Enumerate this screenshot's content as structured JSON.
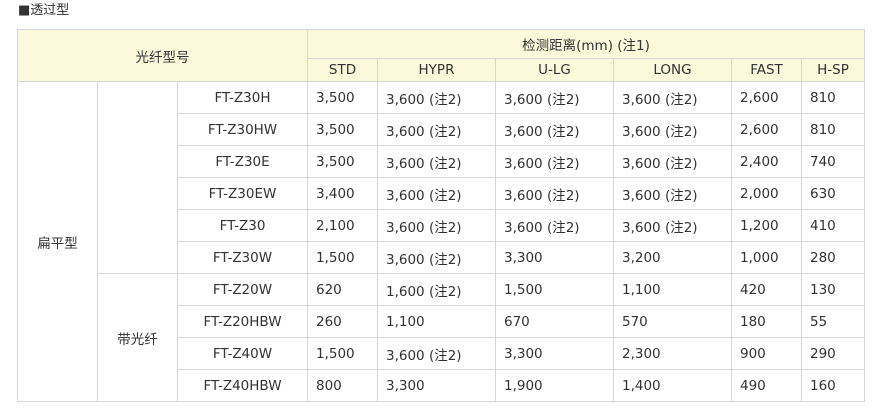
{
  "section_title": "■透过型",
  "header": {
    "model_label": "光纤型号",
    "distance_label": "检测距离(mm) (注1)",
    "columns": [
      "STD",
      "HYPR",
      "U-LG",
      "LONG",
      "FAST",
      "H-SP"
    ]
  },
  "category": "扁平型",
  "subgroups": [
    {
      "label": "",
      "rows": [
        {
          "model": "FT-Z30H",
          "values": [
            "3,500",
            "3,600 (注2)",
            "3,600 (注2)",
            "3,600 (注2)",
            "2,600",
            "810"
          ]
        },
        {
          "model": "FT-Z30HW",
          "values": [
            "3,500",
            "3,600 (注2)",
            "3,600 (注2)",
            "3,600 (注2)",
            "2,600",
            "810"
          ]
        },
        {
          "model": "FT-Z30E",
          "values": [
            "3,500",
            "3,600 (注2)",
            "3,600 (注2)",
            "3,600 (注2)",
            "2,400",
            "740"
          ]
        },
        {
          "model": "FT-Z30EW",
          "values": [
            "3,400",
            "3,600 (注2)",
            "3,600 (注2)",
            "3,600 (注2)",
            "2,000",
            "630"
          ]
        },
        {
          "model": "FT-Z30",
          "values": [
            "2,100",
            "3,600 (注2)",
            "3,600 (注2)",
            "3,600 (注2)",
            "1,200",
            "410"
          ]
        },
        {
          "model": "FT-Z30W",
          "values": [
            "1,500",
            "3,600 (注2)",
            "3,300",
            "3,200",
            "1,000",
            "280"
          ]
        }
      ]
    },
    {
      "label": "带光纤",
      "rows": [
        {
          "model": "FT-Z20W",
          "values": [
            "620",
            "1,600 (注2)",
            "1,500",
            "1,100",
            "420",
            "130"
          ]
        },
        {
          "model": "FT-Z20HBW",
          "values": [
            "260",
            "1,100",
            "670",
            "570",
            "180",
            "55"
          ]
        },
        {
          "model": "FT-Z40W",
          "values": [
            "1,500",
            "3,600 (注2)",
            "3,300",
            "2,300",
            "900",
            "290"
          ]
        },
        {
          "model": "FT-Z40HBW",
          "values": [
            "800",
            "3,300",
            "1,900",
            "1,400",
            "490",
            "160"
          ]
        }
      ]
    }
  ],
  "colors": {
    "header_bg": "#fcf8dc",
    "border": "#d6d6d6",
    "text": "#333333"
  }
}
